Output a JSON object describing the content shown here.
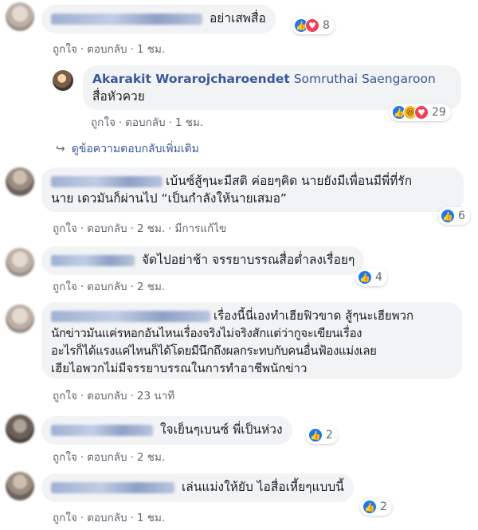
{
  "colors": {
    "link": "#385898",
    "bubble": "#f2f3f5",
    "meta": "#606770",
    "like": "#1877f2",
    "love": "#f33e58"
  },
  "comments": [
    {
      "text": "อย่าเสพสื่อ",
      "like": "ถูกใจ",
      "reply": "ตอบกลับ",
      "time": "1 ชม.",
      "count": "8",
      "reactions": [
        "like-icon",
        "love-icon"
      ]
    },
    {
      "reply_author": "Akarakit Worarojcharoendet",
      "tagged": "Somruthai Saengaroon",
      "text": "สื่อหัวควย",
      "like": "ถูกใจ",
      "reply": "ตอบกลับ",
      "time": "1 ชม.",
      "count": "29",
      "reactions": [
        "like-icon",
        "haha-icon",
        "love-icon"
      ]
    },
    {
      "more_replies": "ดูข้อความตอบกลับเพิ่มเติม"
    },
    {
      "line1": "เบ้นซ์สู้ๆนะมีสติ ค่อยๆคิด นายยังมีเพื่อนมีพี่ที่รัก",
      "line2": "นาย เดวมันก็ผ่านไป “เป็นกำลังให้นายเสมอ”",
      "like": "ถูกใจ",
      "reply": "ตอบกลับ",
      "time": "2 ชม.",
      "edited": "มีการแก้ไข",
      "count": "6"
    },
    {
      "text": "จัดไปอย่าช้า จรรยาบรรณสื่อต่ำลงเรื่อยๆ",
      "like": "ถูกใจ",
      "reply": "ตอบกลับ",
      "time": "2 ชม.",
      "count": "4"
    },
    {
      "line1": "เรื่องนี้นี่เองทำเฮียฟิวขาด สู้ๆนะเฮียพวก",
      "line2": "นักข่าวมันแค่รหอกอันไหนเรื่องจริงไม่จริงสักแต่ว่ากูจะเขียนเรื่อง",
      "line3": "อะไรก็ได้แรงแค่ไหนก็ได้โดยมีนึกถึงผลกระทบกับคนอื่นฟ้องแม่งเลย",
      "line4": "เฮียไอพวกไม่มีจรรยาบรรณในการทำอาชีพนักข่าว",
      "like": "ถูกใจ",
      "reply": "ตอบกลับ",
      "time": "23 นาที"
    },
    {
      "text": "ใจเย็นๆเบนซ์ พี่เป็นห่วง",
      "like": "ถูกใจ",
      "reply": "ตอบกลับ",
      "time": "2 ชม.",
      "count": "2"
    },
    {
      "text": "เล่นแม่งให้ยับ ไอสื่อเหี้ยๆแบบนี้",
      "like": "ถูกใจ",
      "reply": "ตอบกลับ",
      "time": "1 ชม.",
      "count": "2"
    }
  ]
}
